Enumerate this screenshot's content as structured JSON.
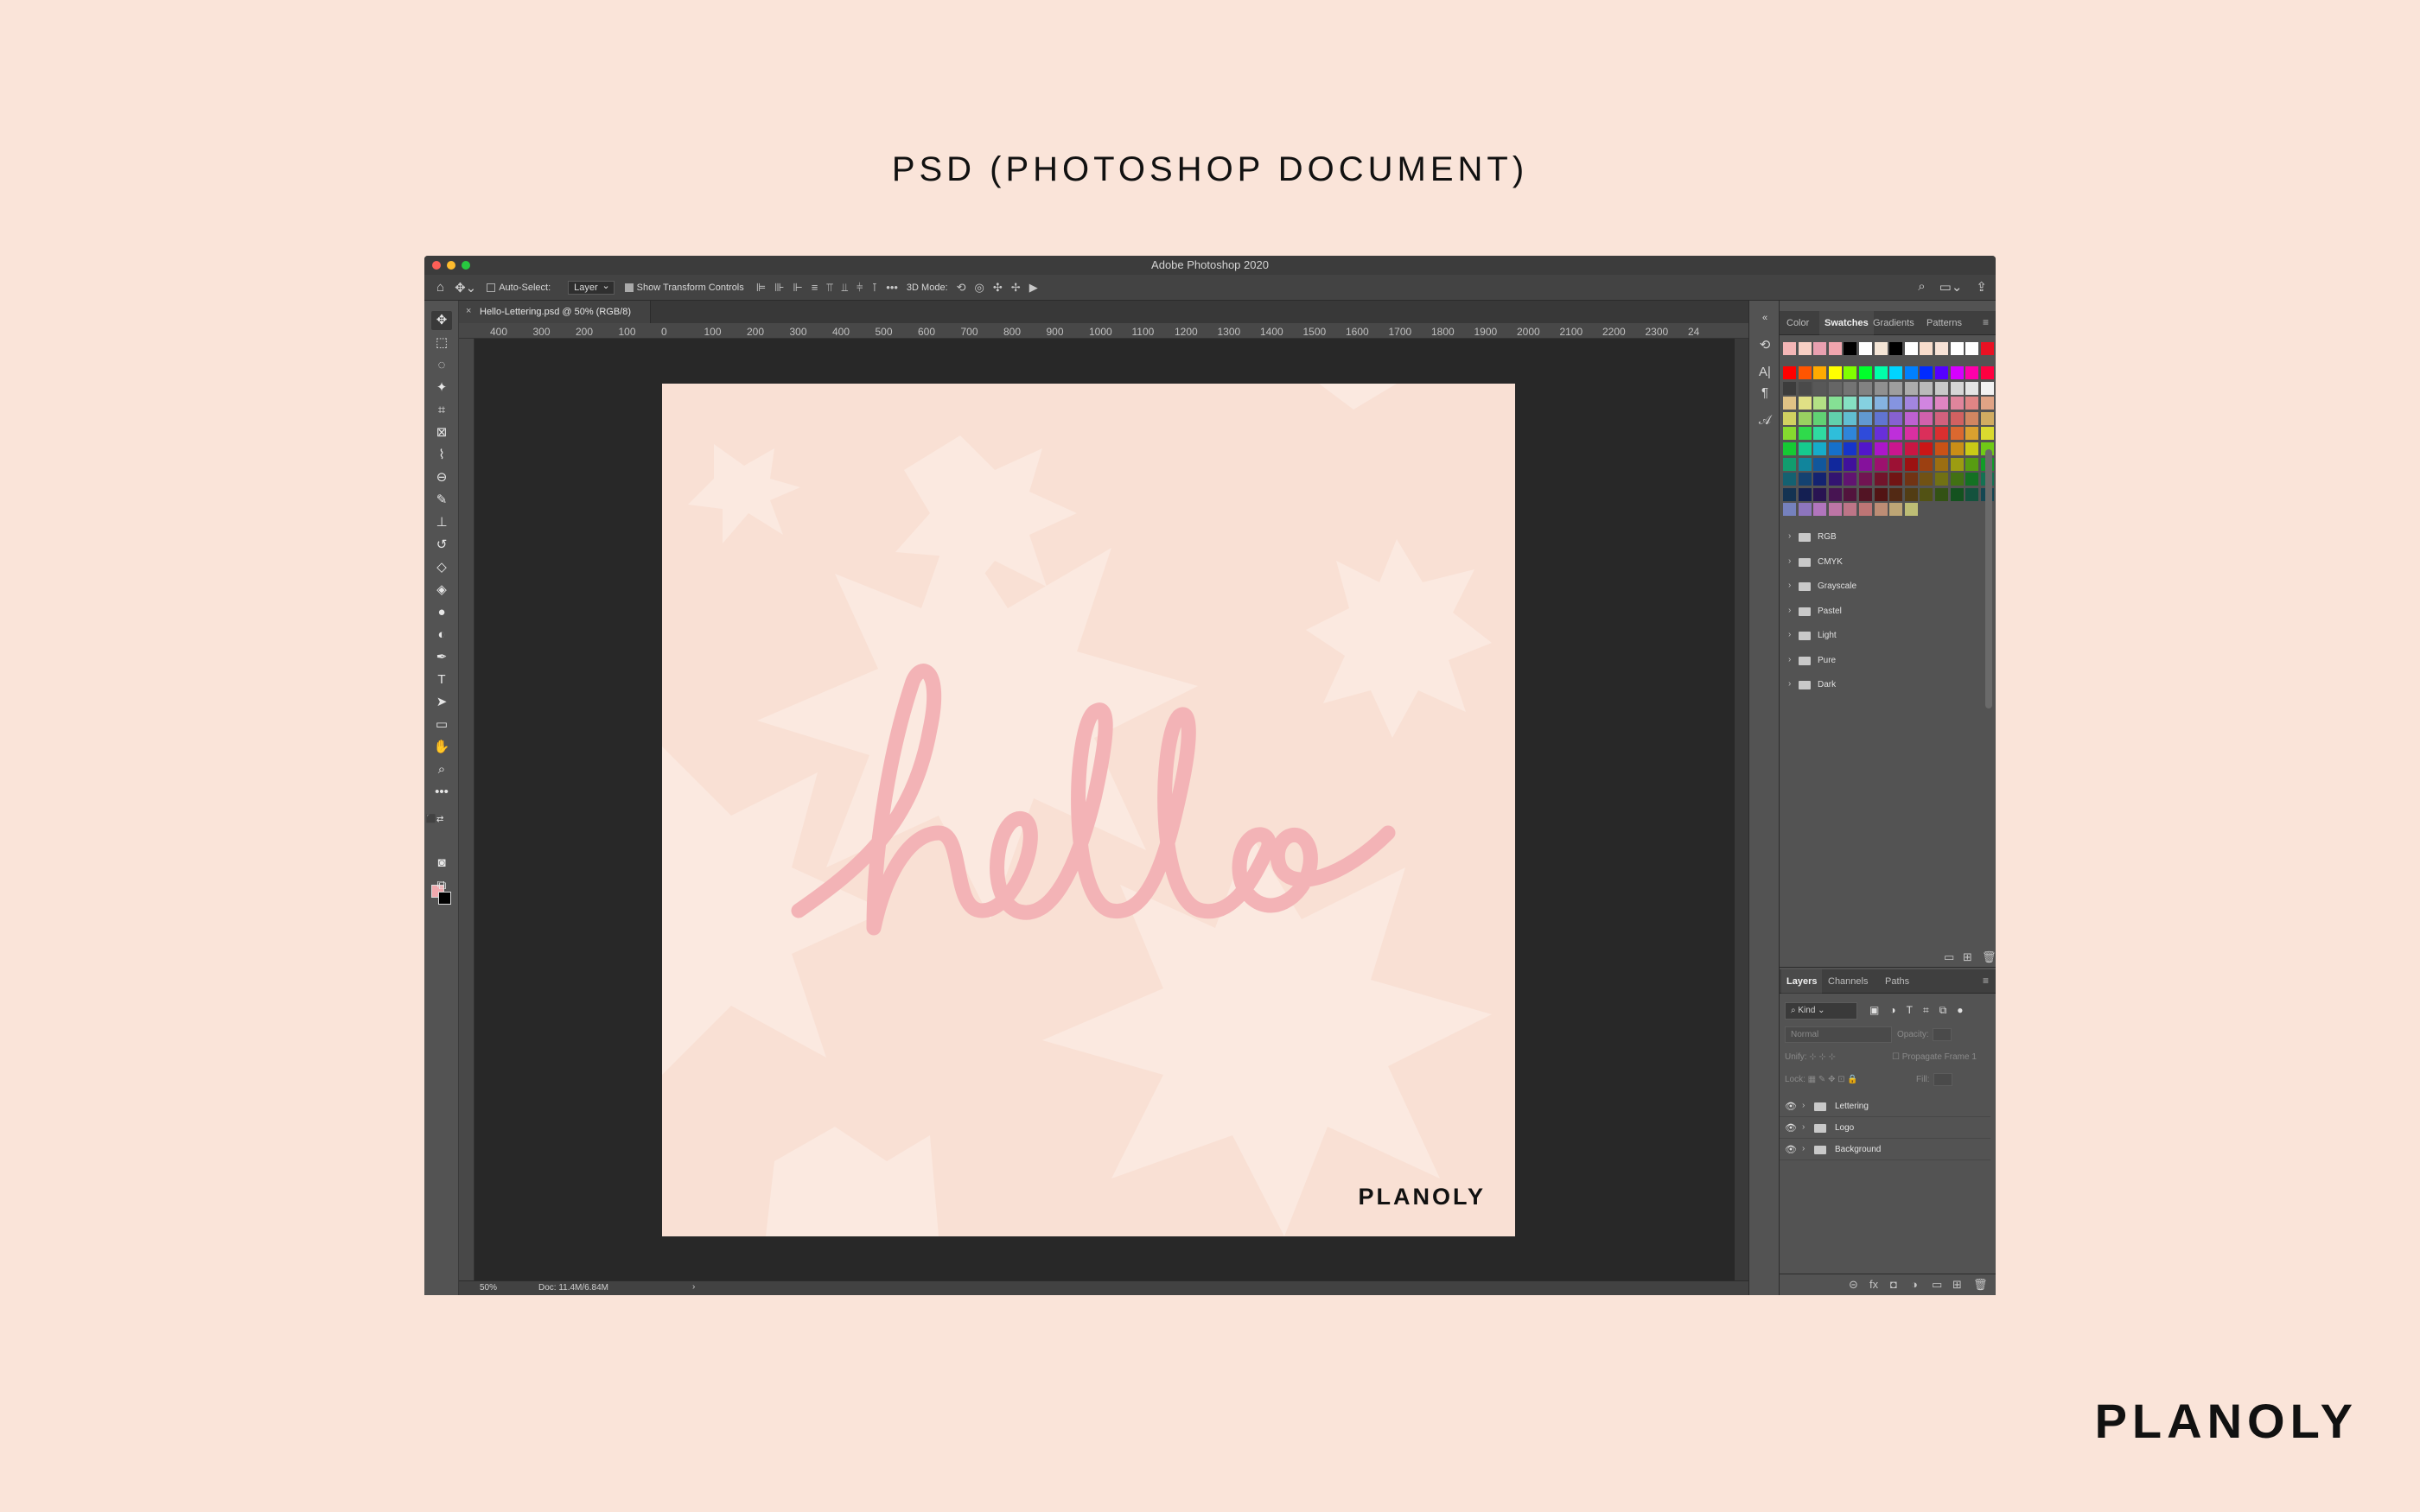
{
  "page": {
    "heading": "PSD (PHOTOSHOP DOCUMENT)",
    "brand": "PLANOLY"
  },
  "window": {
    "title": "Adobe Photoshop 2020"
  },
  "options_bar": {
    "auto_select_label": "Auto-Select:",
    "auto_select_target": "Layer",
    "show_transform_label": "Show Transform Controls",
    "three_d_mode_label": "3D Mode:"
  },
  "document": {
    "tab_title": "Hello-Lettering.psd @ 50% (RGB/8)",
    "zoom": "50%",
    "doc_size": "Doc: 11.4M/6.84M",
    "artwork_text": "hello",
    "artwork_logo": "PLANOLY"
  },
  "ruler": {
    "labels": [
      "400",
      "300",
      "200",
      "100",
      "0",
      "100",
      "200",
      "300",
      "400",
      "500",
      "600",
      "700",
      "800",
      "900",
      "1000",
      "1100",
      "1200",
      "1300",
      "1400",
      "1500",
      "1600",
      "1700",
      "1800",
      "1900",
      "2000",
      "2100",
      "2200",
      "2300",
      "24"
    ]
  },
  "swatches_panel": {
    "tabs": [
      "Color",
      "Swatches",
      "Gradients",
      "Patterns"
    ],
    "active_tab": "Swatches",
    "recent": [
      "#f4b6b6",
      "#f7cfc4",
      "#e9a0b0",
      "#f0a5ae",
      "#000000",
      "#ffffff",
      "#f4e5d6",
      "#000000",
      "#ffffff",
      "#f7dccb",
      "#f7e2d6",
      "#ffffff",
      "#ffffff",
      "#e81123",
      "#9fb8d8"
    ],
    "groups": [
      "RGB",
      "CMYK",
      "Grayscale",
      "Pastel",
      "Light",
      "Pure",
      "Dark"
    ]
  },
  "layers_panel": {
    "tabs": [
      "Layers",
      "Channels",
      "Paths"
    ],
    "active_tab": "Layers",
    "filter_kind": "Kind",
    "blend_mode": "Normal",
    "opacity_label": "Opacity:",
    "unify_label": "Unify:",
    "propagate_label": "Propagate Frame 1",
    "lock_label": "Lock:",
    "fill_label": "Fill:",
    "layers": [
      "Lettering",
      "Logo",
      "Background"
    ]
  },
  "colors": {
    "accent_pink": "#f0a9ae",
    "app_bg": "#535353",
    "canvas_bg": "#282828",
    "artboard_bg": "#f9e0d4"
  }
}
